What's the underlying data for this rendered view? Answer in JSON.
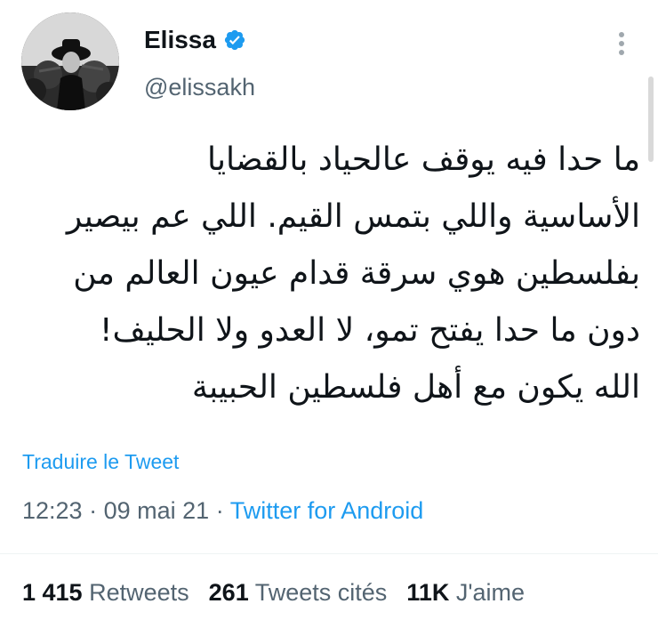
{
  "author": {
    "display_name": "Elissa",
    "handle": "@elissakh",
    "verified": true,
    "avatar_icon": "profile-photo"
  },
  "tweet": {
    "lines": [
      "ما حدا فيه يوقف عالحياد بالقضايا",
      "الأساسية واللي بتمس القيم. اللي عم بيصير",
      "بفلسطين هوي سرقة قدام عيون العالم من",
      "دون ما حدا يفتح تمو، لا العدو ولا الحليف!",
      "الله يكون مع أهل فلسطين الحبيبة"
    ],
    "translate_label": "Traduire le Tweet",
    "time": "12:23",
    "date": "09 mai 21",
    "separator": "·",
    "source": "Twitter for Android"
  },
  "stats": {
    "retweets_count": "1 415",
    "retweets_label": "Retweets",
    "quotes_count": "261",
    "quotes_label": "Tweets cités",
    "likes_count": "11K",
    "likes_label": "J'aime"
  },
  "colors": {
    "accent": "#1d9bf0",
    "text_primary": "#0f1419",
    "text_secondary": "#536471"
  },
  "icons": {
    "verified": "verified-badge-icon",
    "more": "more-vertical-icon"
  }
}
